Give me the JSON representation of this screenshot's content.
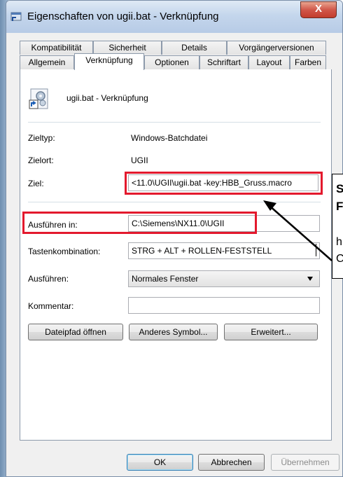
{
  "window": {
    "title": "Eigenschaften von ugii.bat - Verknüpfung",
    "close_glyph": "X"
  },
  "tabs_row1": [
    "Kompatibilität",
    "Sicherheit",
    "Details",
    "Vorgängerversionen"
  ],
  "tabs_row2": [
    "Allgemein",
    "Verknüpfung",
    "Optionen",
    "Schriftart",
    "Layout",
    "Farben"
  ],
  "active_tab": "Verknüpfung",
  "shortcut": {
    "name": "ugii.bat - Verknüpfung",
    "zieltyp_label": "Zieltyp:",
    "zieltyp_value": "Windows-Batchdatei",
    "zielort_label": "Zielort:",
    "zielort_value": "UGII",
    "ziel_label": "Ziel:",
    "ziel_value": "<11.0\\UGII\\ugii.bat -key:HBB_Gruss.macro",
    "ausfuehren_in_label": "Ausführen in:",
    "ausfuehren_in_value": "C:\\Siemens\\NX11.0\\UGII",
    "tastenkombination_label": "Tastenkombination:",
    "tastenkombination_value": "STRG + ALT + ROLLEN-FESTSTELL",
    "ausfuehren_label": "Ausführen:",
    "ausfuehren_value": "Normales Fenster",
    "kommentar_label": "Kommentar:",
    "kommentar_value": ""
  },
  "action_buttons": {
    "dateipfad": "Dateipfad öffnen",
    "symbol": "Anderes Symbol...",
    "erweitert": "Erweitert..."
  },
  "dialog_buttons": {
    "ok": "OK",
    "abbrechen": "Abbrechen",
    "uebernehmen": "Übernehmen"
  },
  "callout": {
    "line1": "S",
    "line2": "F",
    "line3": "h",
    "line4": "C"
  },
  "colors": {
    "highlight": "#e3192d",
    "titlebar": "#c4d6ec",
    "close": "#c23c2c"
  }
}
